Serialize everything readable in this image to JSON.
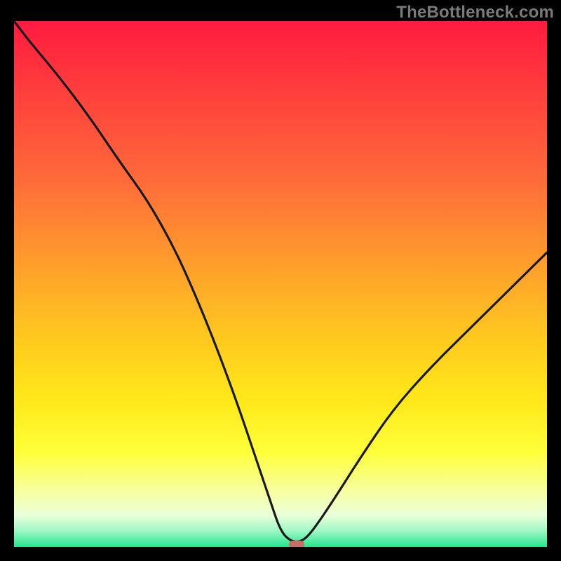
{
  "watermark": "TheBottleneck.com",
  "colors": {
    "page_bg": "#000000",
    "watermark": "#7a7a7a",
    "curve": "#1a1a1a",
    "marker": "#c96d66",
    "gradient_top": "#ff1a3f",
    "gradient_bottom": "#25e58b"
  },
  "chart_data": {
    "type": "line",
    "title": "",
    "axes_hidden": true,
    "xlim": [
      0,
      100
    ],
    "ylim": [
      0,
      100
    ],
    "x": [
      0,
      3,
      8,
      14,
      20,
      25,
      30,
      34,
      38,
      42,
      45,
      48,
      50,
      52,
      54,
      56,
      60,
      65,
      71,
      78,
      86,
      94,
      100
    ],
    "y": [
      100,
      96,
      90,
      82,
      73,
      66,
      57,
      48,
      38,
      27,
      18,
      9,
      3,
      1,
      1,
      3,
      9,
      17,
      26,
      34,
      42,
      50,
      56
    ],
    "minimum_marker": {
      "x": 53,
      "y": 0.5,
      "shape": "rounded-rect"
    },
    "description": "Single V-shaped curve over a vertical red-to-green gradient; minimum near x≈53 marked with a small rounded indicator at the bottom."
  }
}
